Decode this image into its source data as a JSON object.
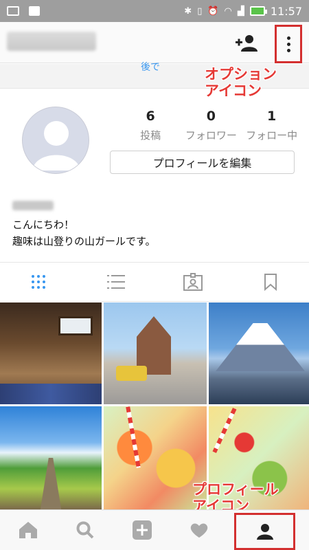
{
  "status_bar": {
    "time": "11:57",
    "icons": [
      "image-icon",
      "bag-icon",
      "bluetooth-icon",
      "vibrate-icon",
      "alarm-icon",
      "wifi-icon",
      "signal-icon",
      "battery-charging-icon"
    ]
  },
  "header": {
    "add_user_icon": "add-user-icon",
    "options_icon": "more-vertical-icon"
  },
  "banner": {
    "text": "後で"
  },
  "callouts": {
    "options_line1": "オプション",
    "options_line2": "アイコン",
    "profile_line1": "プロフィール",
    "profile_line2": "アイコン"
  },
  "profile": {
    "posts_count": "6",
    "posts_label": "投稿",
    "followers_count": "0",
    "followers_label": "フォロワー",
    "following_count": "1",
    "following_label": "フォロー中",
    "edit_button": "プロフィールを編集",
    "bio_line1": "こんにちわ！",
    "bio_line2": "趣味は山登りの山ガールです。"
  },
  "tabs": [
    {
      "name": "grid-view",
      "icon": "grid-icon",
      "active": true
    },
    {
      "name": "list-view",
      "icon": "list-icon",
      "active": false
    },
    {
      "name": "tagged",
      "icon": "tagged-person-icon",
      "active": false
    },
    {
      "name": "saved",
      "icon": "bookmark-icon",
      "active": false
    }
  ],
  "colors": {
    "accent": "#3897f0",
    "annotation": "#d32f2f"
  },
  "bottom_nav": [
    {
      "name": "home",
      "icon": "home-icon"
    },
    {
      "name": "search",
      "icon": "search-icon"
    },
    {
      "name": "add",
      "icon": "add-post-icon"
    },
    {
      "name": "activity",
      "icon": "heart-icon"
    },
    {
      "name": "profile",
      "icon": "profile-icon"
    }
  ]
}
